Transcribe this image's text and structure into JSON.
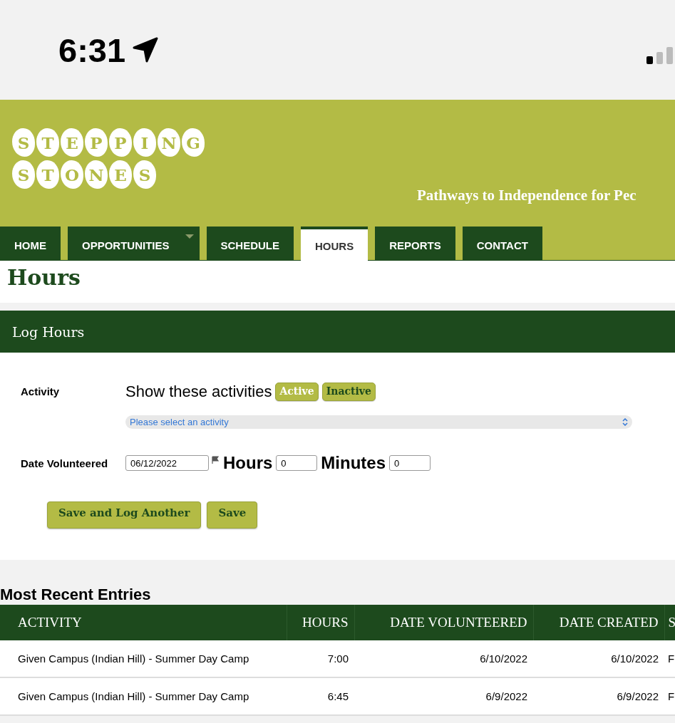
{
  "status_bar": {
    "time": "6:31"
  },
  "header": {
    "logo_lines": [
      [
        "S",
        "T",
        "E",
        "P",
        "P",
        "I",
        "N",
        "G"
      ],
      [
        "S",
        "T",
        "O",
        "N",
        "E",
        "S"
      ]
    ],
    "tagline": "Pathways to Independence for Pec"
  },
  "tabs": [
    {
      "label": "HOME",
      "selected": false,
      "has_menu": false
    },
    {
      "label": "OPPORTUNITIES",
      "selected": false,
      "has_menu": true
    },
    {
      "label": "SCHEDULE",
      "selected": false,
      "has_menu": false
    },
    {
      "label": "HOURS",
      "selected": true,
      "has_menu": false
    },
    {
      "label": "REPORTS",
      "selected": false,
      "has_menu": false
    },
    {
      "label": "CONTACT",
      "selected": false,
      "has_menu": false
    }
  ],
  "page_title": "Hours",
  "log_hours": {
    "title": "Log Hours",
    "activity_label": "Activity",
    "filter_label": "Show these activities",
    "filters": [
      {
        "label": "Active",
        "selected": true
      },
      {
        "label": "Inactive",
        "selected": false
      }
    ],
    "activity_select": {
      "placeholder": "Please select an activity"
    },
    "date_label": "Date Volunteered",
    "date_value": "06/12/2022",
    "hours_label": "Hours",
    "hours_value": "0",
    "minutes_label": "Minutes",
    "minutes_value": "0",
    "buttons": [
      "Save and Log Another",
      "Save"
    ]
  },
  "recent": {
    "title": "Most Recent Entries",
    "columns": [
      "ACTIVITY",
      "HOURS",
      "DATE VOLUNTEERED",
      "DATE CREATED",
      "S"
    ],
    "rows": [
      [
        "Given Campus (Indian Hill) - Summer Day Camp",
        "7:00",
        "6/10/2022",
        "6/10/2022",
        "F"
      ],
      [
        "Given Campus (Indian Hill) - Summer Day Camp",
        "6:45",
        "6/9/2022",
        "6/9/2022",
        "F"
      ]
    ]
  }
}
